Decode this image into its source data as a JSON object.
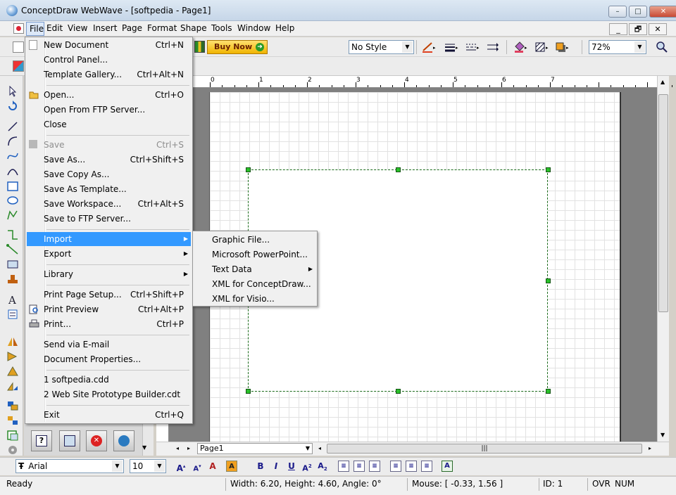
{
  "window": {
    "title": "ConceptDraw WebWave - [softpedia - Page1]",
    "controls": {
      "minimize": "–",
      "maximize": "□",
      "close": "✕"
    }
  },
  "menubar": {
    "items": [
      "File",
      "Edit",
      "View",
      "Insert",
      "Page",
      "Format",
      "Shape",
      "Tools",
      "Window",
      "Help"
    ],
    "mdi_controls": {
      "minimize": "_",
      "restore": "🗗",
      "close": "✕"
    }
  },
  "toolbar": {
    "buy_now": "Buy Now",
    "style_combo": "No Style",
    "zoom_combo": "72%"
  },
  "ruler": {
    "numbers": [
      "0",
      "1",
      "2",
      "3",
      "4",
      "5",
      "6",
      "7"
    ]
  },
  "file_menu": {
    "items": [
      {
        "label": "New Document",
        "shortcut": "Ctrl+N"
      },
      {
        "label": "Control Panel...",
        "shortcut": ""
      },
      {
        "label": "Template Gallery...",
        "shortcut": "Ctrl+Alt+N"
      },
      {
        "label": "Open...",
        "shortcut": "Ctrl+O"
      },
      {
        "label": "Open From FTP Server...",
        "shortcut": ""
      },
      {
        "label": "Close",
        "shortcut": ""
      },
      {
        "label": "Save",
        "shortcut": "Ctrl+S",
        "disabled": true
      },
      {
        "label": "Save As...",
        "shortcut": "Ctrl+Shift+S"
      },
      {
        "label": "Save Copy As...",
        "shortcut": ""
      },
      {
        "label": "Save As Template...",
        "shortcut": ""
      },
      {
        "label": "Save Workspace...",
        "shortcut": "Ctrl+Alt+S"
      },
      {
        "label": "Save to FTP Server...",
        "shortcut": ""
      },
      {
        "label": "Import",
        "shortcut": "",
        "submenu": true,
        "highlighted": true
      },
      {
        "label": "Export",
        "shortcut": "",
        "submenu": true
      },
      {
        "label": "Library",
        "shortcut": "",
        "submenu": true
      },
      {
        "label": "Print Page Setup...",
        "shortcut": "Ctrl+Shift+P"
      },
      {
        "label": "Print Preview",
        "shortcut": "Ctrl+Alt+P"
      },
      {
        "label": "Print...",
        "shortcut": "Ctrl+P"
      },
      {
        "label": "Send via E-mail",
        "shortcut": ""
      },
      {
        "label": "Document Properties...",
        "shortcut": ""
      },
      {
        "label": "1 softpedia.cdd",
        "shortcut": ""
      },
      {
        "label": "2 Web Site Prototype Builder.cdt",
        "shortcut": ""
      },
      {
        "label": "Exit",
        "shortcut": "Ctrl+Q"
      }
    ]
  },
  "import_submenu": {
    "items": [
      {
        "label": "Graphic File..."
      },
      {
        "label": "Microsoft PowerPoint..."
      },
      {
        "label": "Text Data",
        "submenu": true
      },
      {
        "label": "XML for ConceptDraw..."
      },
      {
        "label": "XML for Visio..."
      }
    ]
  },
  "page_tabs": {
    "current": "Page1"
  },
  "format_bar": {
    "font": "Arial",
    "size": "10",
    "font_icon": "Ŧ"
  },
  "statusbar": {
    "ready": "Ready",
    "dimensions": "Width: 6.20,  Height: 4.60,  Angle: 0°",
    "mouse": "Mouse: [ -0.33, 1.56 ]",
    "id": "ID: 1",
    "ovr": "OVR",
    "num": "NUM"
  },
  "icons": {
    "app": "conceptdraw-logo-icon",
    "document": "document-icon",
    "open": "folder-open-icon",
    "save": "floppy-disk-icon",
    "print_preview": "print-preview-icon",
    "print": "printer-icon"
  },
  "colors": {
    "menu_highlight": "#3399ff",
    "selection_handle": "#2ac02a",
    "buy_now": "#f0b400"
  }
}
